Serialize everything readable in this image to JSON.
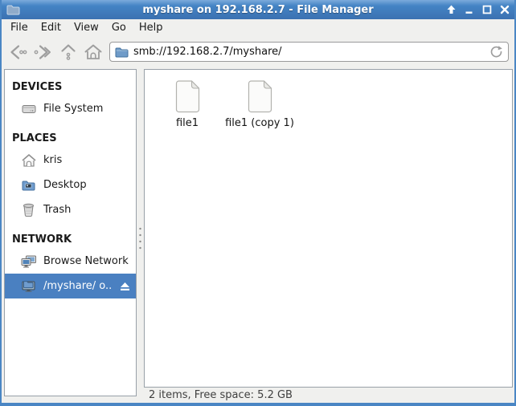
{
  "window": {
    "title": "myshare on 192.168.2.7 - File Manager",
    "app_icon": "folder-icon",
    "control_icons": [
      "shade-icon",
      "minimize-icon",
      "maximize-icon",
      "close-icon"
    ]
  },
  "menu": {
    "items": [
      "File",
      "Edit",
      "View",
      "Go",
      "Help"
    ]
  },
  "toolbar": {
    "button_icons": [
      "back-icon",
      "forward-icon",
      "up-icon",
      "home-icon"
    ],
    "path_icon": "folder-icon",
    "path_value": "smb://192.168.2.7/myshare/",
    "reload_icon": "reload-icon"
  },
  "sidebar": {
    "sections": [
      {
        "title": "DEVICES",
        "items": [
          {
            "label": "File System",
            "icon": "harddrive-icon",
            "selected": false
          }
        ]
      },
      {
        "title": "PLACES",
        "items": [
          {
            "label": "kris",
            "icon": "home-icon",
            "selected": false
          },
          {
            "label": "Desktop",
            "icon": "desktop-folder-icon",
            "selected": false
          },
          {
            "label": "Trash",
            "icon": "trash-icon",
            "selected": false
          }
        ]
      },
      {
        "title": "NETWORK",
        "items": [
          {
            "label": "Browse Network",
            "icon": "network-icon",
            "selected": false
          },
          {
            "label": "/myshare/ o...",
            "icon": "remote-share-icon",
            "selected": true,
            "eject_icon": "eject-icon"
          }
        ]
      }
    ]
  },
  "files": [
    {
      "name": "file1",
      "icon": "file-icon"
    },
    {
      "name": "file1 (copy 1)",
      "icon": "file-icon"
    }
  ],
  "statusbar": {
    "text": "2 items, Free space: 5.2 GB"
  },
  "colors": {
    "titlebar_blue": "#4484c5",
    "selection_blue": "#4a80c1",
    "window_border": "#4a86c4",
    "chrome_bg": "#f0f0ee"
  }
}
